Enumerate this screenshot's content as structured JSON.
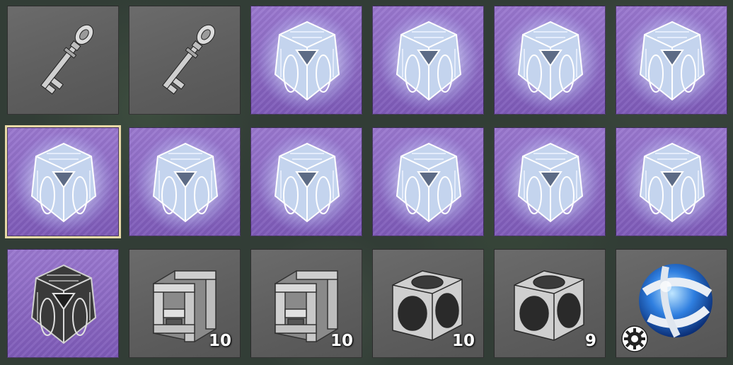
{
  "inventory": {
    "slots": [
      {
        "item": "key",
        "rarity": "common",
        "quantity": ""
      },
      {
        "item": "key",
        "rarity": "common",
        "quantity": ""
      },
      {
        "item": "glowing-cube",
        "rarity": "rare",
        "quantity": ""
      },
      {
        "item": "glowing-cube",
        "rarity": "rare",
        "quantity": ""
      },
      {
        "item": "glowing-cube",
        "rarity": "rare",
        "quantity": ""
      },
      {
        "item": "glowing-cube",
        "rarity": "rare",
        "quantity": ""
      },
      {
        "item": "glowing-cube",
        "rarity": "rare",
        "quantity": "",
        "selected": true
      },
      {
        "item": "glowing-cube",
        "rarity": "rare",
        "quantity": ""
      },
      {
        "item": "glowing-cube",
        "rarity": "rare",
        "quantity": ""
      },
      {
        "item": "glowing-cube",
        "rarity": "rare",
        "quantity": ""
      },
      {
        "item": "glowing-cube",
        "rarity": "rare",
        "quantity": ""
      },
      {
        "item": "glowing-cube",
        "rarity": "rare",
        "quantity": ""
      },
      {
        "item": "dark-cube",
        "rarity": "rare",
        "quantity": ""
      },
      {
        "item": "cage-block",
        "rarity": "common",
        "quantity": "10"
      },
      {
        "item": "cage-block",
        "rarity": "common",
        "quantity": "10"
      },
      {
        "item": "hollow-cube",
        "rarity": "common",
        "quantity": "10"
      },
      {
        "item": "hollow-cube",
        "rarity": "common",
        "quantity": "9"
      },
      {
        "item": "blue-orb",
        "rarity": "common",
        "quantity": "",
        "badge": "gear-icon"
      }
    ]
  },
  "colors": {
    "common_slot": "#5e5e5e",
    "rare_slot": "#8a68c4",
    "selected_border": "#e8d9a6",
    "quantity_text": "#ffffff"
  }
}
